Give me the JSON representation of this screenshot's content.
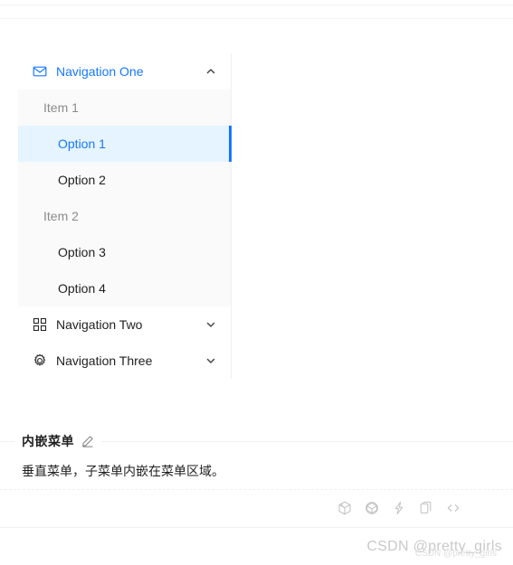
{
  "menu": {
    "nav_one": {
      "label": "Navigation One",
      "icon": "mail-icon",
      "arrow": "chevron-up-icon",
      "expanded": true,
      "groups": [
        {
          "title": "Item 1",
          "items": [
            {
              "label": "Option 1",
              "selected": true
            },
            {
              "label": "Option 2",
              "selected": false
            }
          ]
        },
        {
          "title": "Item 2",
          "items": [
            {
              "label": "Option 3",
              "selected": false
            },
            {
              "label": "Option 4",
              "selected": false
            }
          ]
        }
      ]
    },
    "nav_two": {
      "label": "Navigation Two",
      "icon": "appstore-grid-icon",
      "arrow": "chevron-down-icon"
    },
    "nav_three": {
      "label": "Navigation Three",
      "icon": "gear-icon",
      "arrow": "chevron-down-icon"
    }
  },
  "section": {
    "title": "内嵌菜单",
    "edit_icon": "pencil-icon",
    "description": "垂直菜单，子菜单内嵌在菜单区域。"
  },
  "actions": [
    {
      "name": "codesandbox-icon",
      "title": "CodeSandbox"
    },
    {
      "name": "codepen-icon",
      "title": "CodePen"
    },
    {
      "name": "stackblitz-lightning-icon",
      "title": "StackBlitz"
    },
    {
      "name": "copy-icon",
      "title": "Copy"
    },
    {
      "name": "code-brackets-icon",
      "title": "Show code"
    }
  ],
  "watermark": {
    "primary": "CSDN @pretty_girls",
    "ghost": "CSDN @pretty_girls"
  },
  "colors": {
    "primary": "#1677ff",
    "selected_bg": "#e6f4ff",
    "submenu_bg": "#fafafa",
    "border": "#f0f0f0",
    "muted_text": "rgba(0,0,0,0.45)"
  }
}
